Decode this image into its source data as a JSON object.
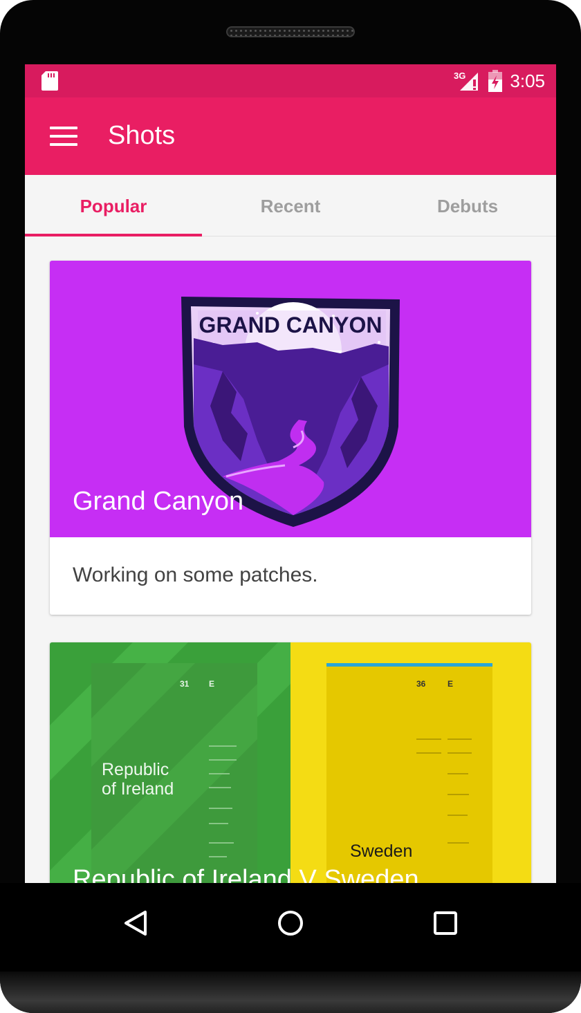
{
  "status_bar": {
    "time": "3:05",
    "network": "3G",
    "background_color": "#d81b5e"
  },
  "app_bar": {
    "title": "Shots",
    "menu_icon": "menu-icon",
    "background_color": "#e91e63"
  },
  "tabs": [
    {
      "label": "Popular",
      "active": true
    },
    {
      "label": "Recent",
      "active": false
    },
    {
      "label": "Debuts",
      "active": false
    }
  ],
  "shots": [
    {
      "title": "Grand Canyon",
      "description": "Working on some patches.",
      "image": {
        "badge_text": "GRAND CANYON",
        "background_color": "#c62ef4"
      }
    },
    {
      "title": "Republic of Ireland V Sweden",
      "image": {
        "left_poster": {
          "title": "Republic of Ireland",
          "number": "31",
          "letter": "E",
          "color": "#3f9f3a"
        },
        "right_poster": {
          "title": "Sweden",
          "number": "36",
          "letter": "E",
          "color": "#f2d600"
        }
      }
    }
  ],
  "nav_bar": [
    "back-icon",
    "home-icon",
    "recents-icon"
  ]
}
